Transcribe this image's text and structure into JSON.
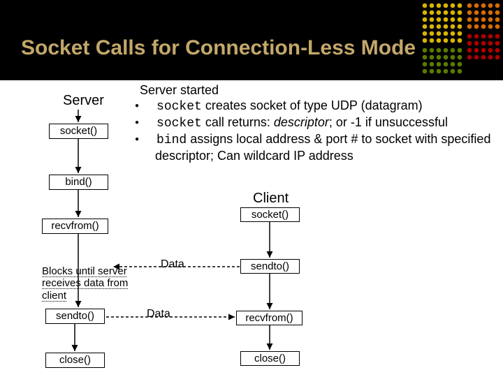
{
  "title": "Socket Calls for Connection-Less Mode",
  "server": {
    "heading": "Server",
    "boxes": {
      "socket": "socket()",
      "bind": "bind()",
      "recvfrom": "recvfrom()",
      "sendto": "sendto()",
      "close": "close()"
    }
  },
  "client": {
    "heading": "Client",
    "boxes": {
      "socket": "socket()",
      "sendto": "sendto()",
      "recvfrom": "recvfrom()",
      "close": "close()"
    }
  },
  "note": "Blocks until server receives data from client",
  "data_label": "Data",
  "explain": {
    "heading": "Server started",
    "b1_code": "socket",
    "b1_text": " creates socket of type UDP (datagram)",
    "b2_code": "socket",
    "b2_text_a": " call returns:  ",
    "b2_desc": "descriptor",
    "b2_text_b": ";  or -1 if unsuccessful",
    "b3_code": "bind",
    "b3_text": " assigns local address & port # to socket with specified descriptor; Can wildcard IP address"
  }
}
